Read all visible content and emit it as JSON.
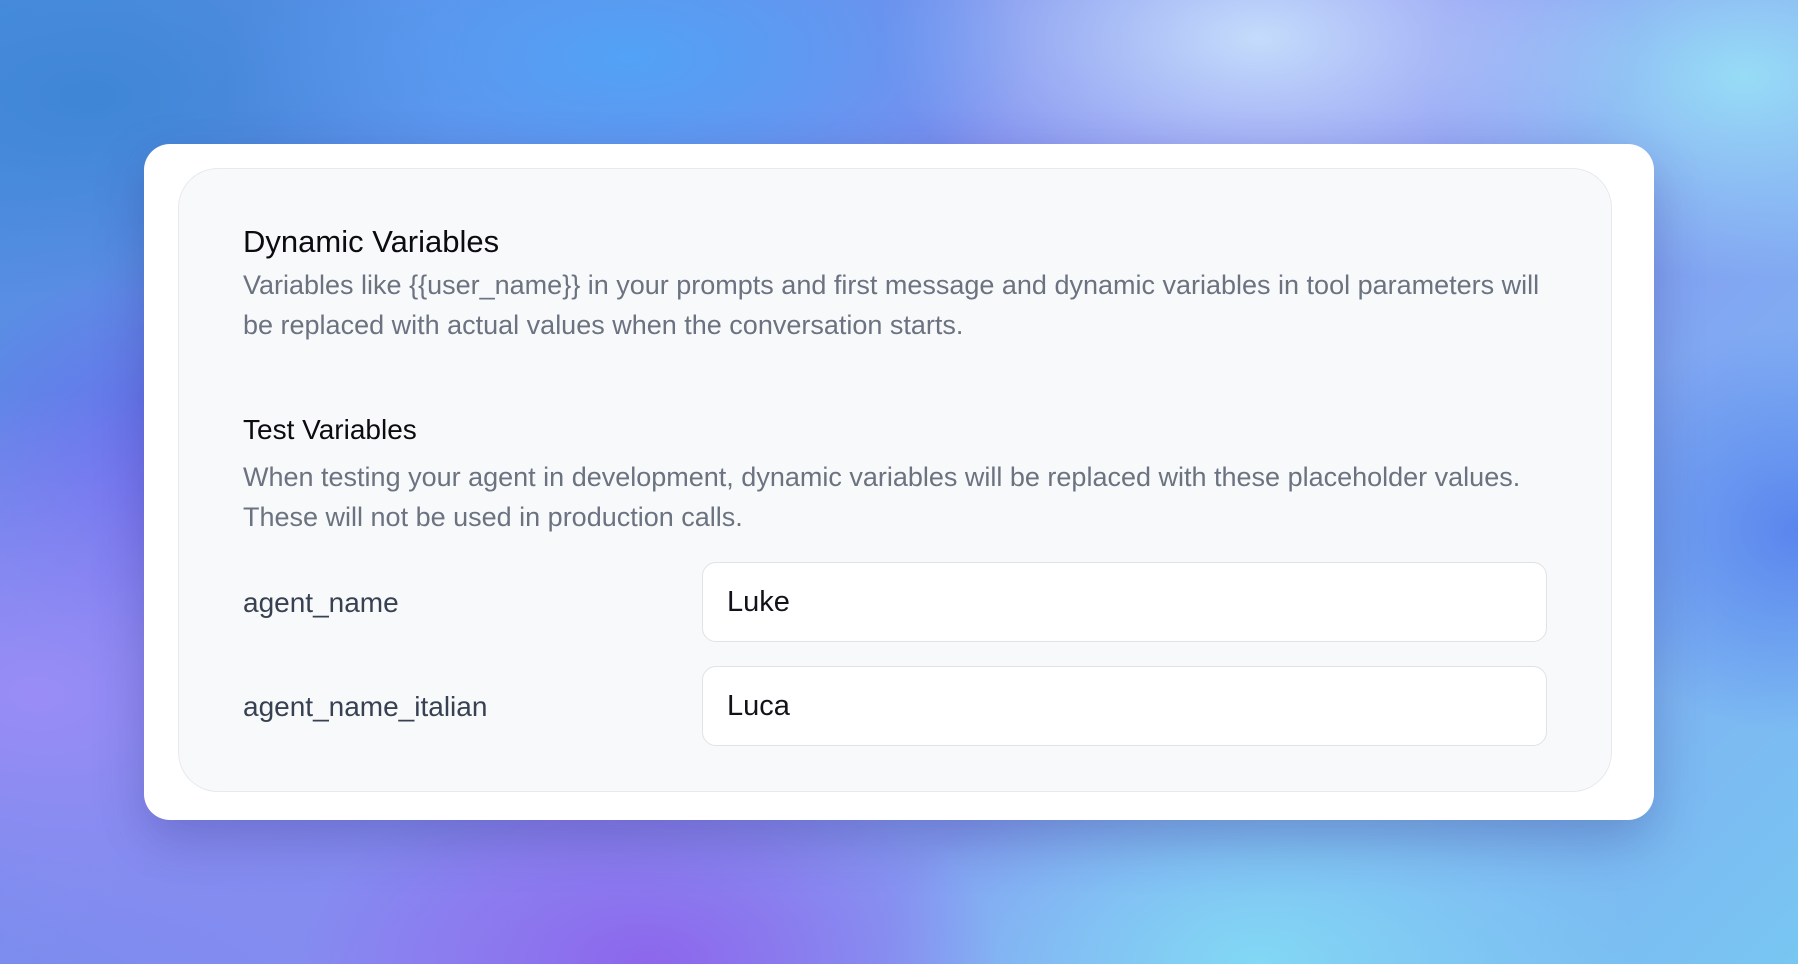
{
  "dynamic_variables": {
    "title": "Dynamic Variables",
    "description": "Variables like {{user_name}} in your prompts and first message and dynamic variables in tool parameters will be replaced with actual values when the conversation starts."
  },
  "test_variables": {
    "title": "Test Variables",
    "description": "When testing your agent in development, dynamic variables will be replaced with these placeholder values. These will not be used in production calls.",
    "variables": [
      {
        "name": "agent_name",
        "value": "Luke"
      },
      {
        "name": "agent_name_italian",
        "value": "Luca"
      }
    ]
  }
}
